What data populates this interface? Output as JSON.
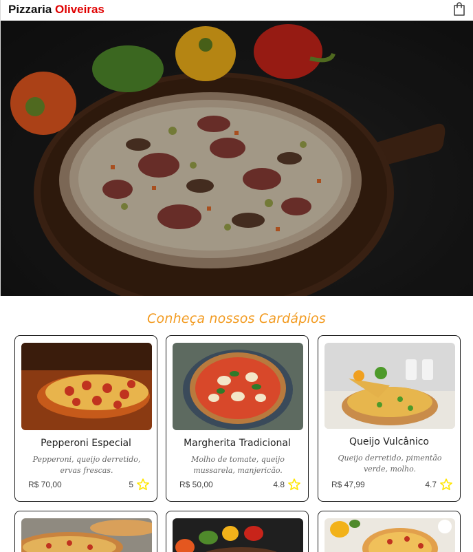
{
  "header": {
    "brand_first": "Pizzaria",
    "brand_second": "Oliveiras",
    "cart_icon": "shopping-bag-icon"
  },
  "section": {
    "title": "Conheça nossos Cardápios"
  },
  "colors": {
    "accent_red": "#e00000",
    "title_orange": "#f29a1f",
    "star_yellow": "#ffe600"
  },
  "menu": [
    {
      "name": "Pepperoni Especial",
      "description": "Pepperoni, queijo derretido, ervas frescas.",
      "price": "R$ 70,00",
      "rating": "5"
    },
    {
      "name": "Margherita Tradicional",
      "description": "Molho de tomate, queijo mussarela, manjericão.",
      "price": "R$ 50,00",
      "rating": "4.8"
    },
    {
      "name": "Queijo Vulcânico",
      "description": "Queijo derretido, pimentão verde, molho.",
      "price": "R$ 47,99",
      "rating": "4.7"
    }
  ]
}
